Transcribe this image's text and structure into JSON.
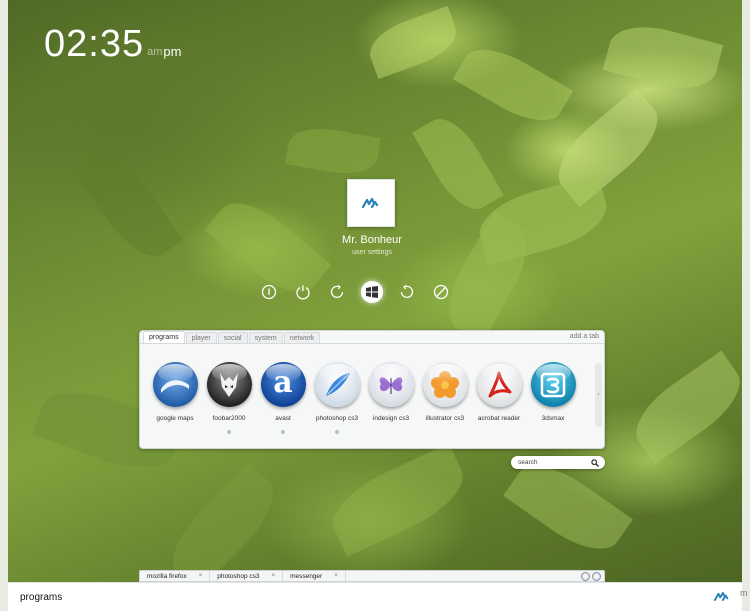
{
  "clock": {
    "time": "02:35",
    "am": "am",
    "pm": "pm"
  },
  "user": {
    "name": "Mr. Bonheur",
    "subtitle": "user settings",
    "tile_icon": "mb-logo-icon"
  },
  "power_buttons": [
    {
      "icon": "info-icon"
    },
    {
      "icon": "power-icon"
    },
    {
      "icon": "refresh-icon"
    },
    {
      "icon": "windows-icon",
      "active": true
    },
    {
      "icon": "restart-icon"
    },
    {
      "icon": "cancel-icon"
    }
  ],
  "panel": {
    "tabs": [
      "programs",
      "player",
      "social",
      "system",
      "network"
    ],
    "active_tab": "programs",
    "add_tab": "add a tab",
    "apps": [
      {
        "label": "google maps",
        "icon": "google-maps-icon",
        "color": "#3d7ec8",
        "dot": false
      },
      {
        "label": "foobar2000",
        "icon": "foobar2000-icon",
        "color": "#2b2b2b",
        "dot": true
      },
      {
        "label": "avast",
        "icon": "avast-icon",
        "color": "#1b5bb5",
        "dot": true
      },
      {
        "label": "photoshop cs3",
        "icon": "photoshop-icon",
        "color": "#4f9be0",
        "dot": true
      },
      {
        "label": "indesign cs3",
        "icon": "indesign-icon",
        "color": "#c9b8e8",
        "dot": false
      },
      {
        "label": "illustrator cs3",
        "icon": "illustrator-icon",
        "color": "#f2a23a",
        "dot": false
      },
      {
        "label": "acrobat reader",
        "icon": "acrobat-icon",
        "color": "#d82a20",
        "dot": false
      },
      {
        "label": "3dsmax",
        "icon": "3dsmax-icon",
        "color": "#1fa0c8",
        "dot": false
      }
    ]
  },
  "search": {
    "placeholder": "search"
  },
  "taskbar": {
    "tasks": [
      {
        "label": "mozilla firefox",
        "close": "×"
      },
      {
        "label": "photoshop cs3",
        "close": "×"
      },
      {
        "label": "messenger",
        "close": "×"
      }
    ]
  },
  "bottom": {
    "label": "programs",
    "side_letter": "m"
  }
}
